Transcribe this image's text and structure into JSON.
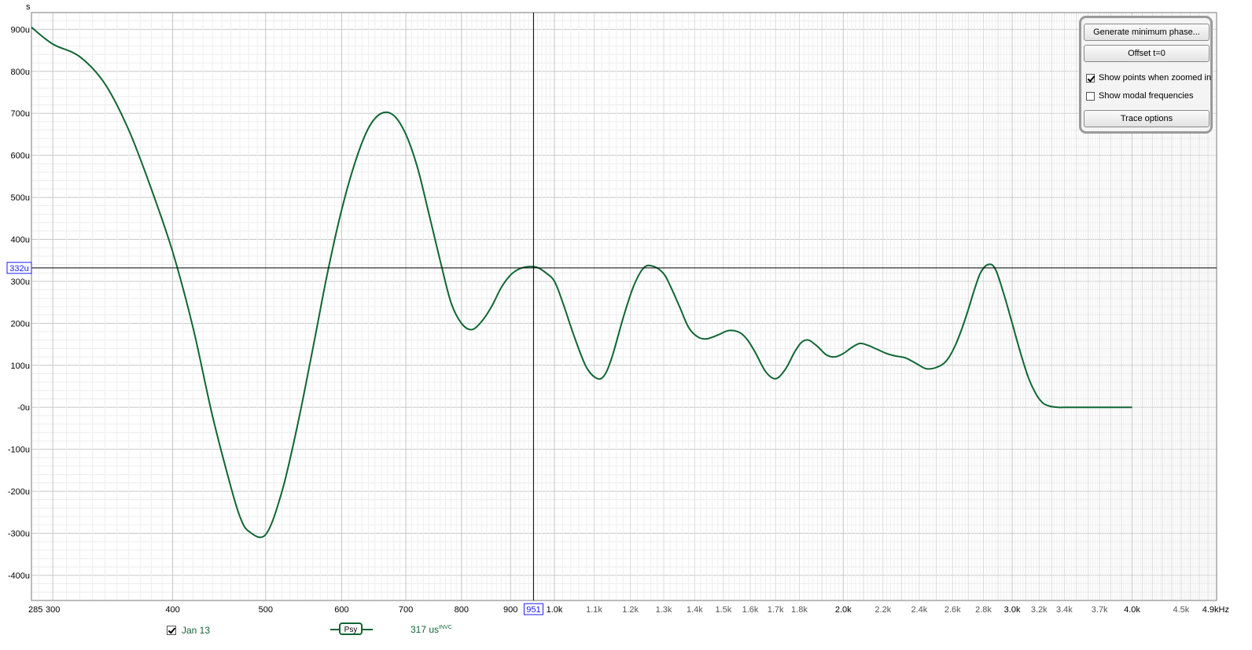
{
  "chart_data": {
    "type": "line",
    "y_unit_label": "s",
    "x_scale": "log",
    "xlim": [
      285,
      4900
    ],
    "ylim": [
      -460,
      940
    ],
    "y_ticks": [
      {
        "value": 900,
        "label": "900u"
      },
      {
        "value": 800,
        "label": "800u"
      },
      {
        "value": 700,
        "label": "700u"
      },
      {
        "value": 600,
        "label": "600u"
      },
      {
        "value": 500,
        "label": "500u"
      },
      {
        "value": 400,
        "label": "400u"
      },
      {
        "value": 300,
        "label": "300u"
      },
      {
        "value": 200,
        "label": "200u"
      },
      {
        "value": 100,
        "label": "100u"
      },
      {
        "value": 0,
        "label": "-0u"
      },
      {
        "value": -100,
        "label": "-100u"
      },
      {
        "value": -200,
        "label": "-200u"
      },
      {
        "value": -300,
        "label": "-300u"
      },
      {
        "value": -400,
        "label": "-400u"
      }
    ],
    "x_ticks": [
      {
        "value": 285,
        "label": "285",
        "major": true
      },
      {
        "value": 300,
        "label": "300",
        "major": true
      },
      {
        "value": 400,
        "label": "400",
        "major": true
      },
      {
        "value": 500,
        "label": "500",
        "major": true
      },
      {
        "value": 600,
        "label": "600",
        "major": true
      },
      {
        "value": 700,
        "label": "700",
        "major": true
      },
      {
        "value": 800,
        "label": "800",
        "major": true
      },
      {
        "value": 900,
        "label": "900",
        "major": true
      },
      {
        "value": 1000,
        "label": "1.0k",
        "major": true
      },
      {
        "value": 1100,
        "label": "1.1k",
        "major": false
      },
      {
        "value": 1200,
        "label": "1.2k",
        "major": false
      },
      {
        "value": 1300,
        "label": "1.3k",
        "major": false
      },
      {
        "value": 1400,
        "label": "1.4k",
        "major": false
      },
      {
        "value": 1500,
        "label": "1.5k",
        "major": false
      },
      {
        "value": 1600,
        "label": "1.6k",
        "major": false
      },
      {
        "value": 1700,
        "label": "1.7k",
        "major": false
      },
      {
        "value": 1800,
        "label": "1.8k",
        "major": false
      },
      {
        "value": 2000,
        "label": "2.0k",
        "major": true
      },
      {
        "value": 2200,
        "label": "2.2k",
        "major": false
      },
      {
        "value": 2400,
        "label": "2.4k",
        "major": false
      },
      {
        "value": 2600,
        "label": "2.6k",
        "major": false
      },
      {
        "value": 2800,
        "label": "2.8k",
        "major": false
      },
      {
        "value": 3000,
        "label": "3.0k",
        "major": true
      },
      {
        "value": 3200,
        "label": "3.2k",
        "major": false
      },
      {
        "value": 3400,
        "label": "3.4k",
        "major": false
      },
      {
        "value": 3700,
        "label": "3.7k",
        "major": false
      },
      {
        "value": 4000,
        "label": "4.0k",
        "major": true
      },
      {
        "value": 4500,
        "label": "4.5k",
        "major": false
      },
      {
        "value": 4900,
        "label": "4.9kHz",
        "major": true
      }
    ],
    "grid": true,
    "cursor": {
      "x": 951,
      "x_label": "951",
      "y": 332,
      "y_label": "332u"
    },
    "series": [
      {
        "name": "Jan 13",
        "color": "#116633",
        "x": [
          285,
          300,
          320,
          340,
          360,
          380,
          400,
          420,
          440,
          460,
          470,
          480,
          500,
          520,
          540,
          560,
          580,
          600,
          620,
          640,
          660,
          680,
          700,
          720,
          740,
          760,
          780,
          800,
          820,
          840,
          860,
          880,
          900,
          920,
          940,
          960,
          980,
          1000,
          1020,
          1050,
          1080,
          1110,
          1130,
          1150,
          1180,
          1210,
          1240,
          1270,
          1300,
          1320,
          1350,
          1380,
          1410,
          1440,
          1480,
          1520,
          1560,
          1590,
          1620,
          1660,
          1700,
          1740,
          1780,
          1810,
          1840,
          1880,
          1920,
          1960,
          2000,
          2040,
          2080,
          2120,
          2170,
          2220,
          2270,
          2320,
          2380,
          2440,
          2500,
          2560,
          2620,
          2680,
          2740,
          2780,
          2830,
          2880,
          2940,
          3000,
          3060,
          3120,
          3180,
          3230,
          3280,
          3350,
          3420,
          3500,
          3580,
          3660,
          3750,
          3850,
          3950,
          4000
        ],
        "y": [
          905,
          865,
          835,
          770,
          660,
          520,
          370,
          190,
          -20,
          -190,
          -260,
          -295,
          -303,
          -200,
          -40,
          140,
          320,
          470,
          585,
          665,
          700,
          695,
          650,
          570,
          460,
          350,
          250,
          200,
          185,
          205,
          240,
          285,
          315,
          330,
          335,
          333,
          320,
          300,
          250,
          165,
          95,
          68,
          80,
          125,
          215,
          290,
          333,
          335,
          318,
          290,
          240,
          190,
          168,
          163,
          172,
          183,
          178,
          160,
          130,
          85,
          68,
          90,
          132,
          155,
          160,
          145,
          125,
          120,
          128,
          142,
          152,
          148,
          138,
          128,
          122,
          118,
          105,
          92,
          95,
          110,
          150,
          210,
          280,
          320,
          340,
          330,
          270,
          200,
          130,
          70,
          30,
          10,
          3,
          0,
          0,
          0,
          0,
          0,
          0,
          0,
          0,
          0
        ]
      }
    ]
  },
  "panel": {
    "generate_label": "Generate minimum phase...",
    "offset_label": "Offset t=0",
    "show_points_label": "Show points when zoomed in",
    "show_points_checked": true,
    "show_modal_label": "Show modal frequencies",
    "show_modal_checked": false,
    "trace_options_label": "Trace options"
  },
  "legend": {
    "series_name": "Jan 13",
    "checked": true,
    "psy_label": "Psy",
    "delay_value": "317 us",
    "delay_sup": "INVC"
  }
}
